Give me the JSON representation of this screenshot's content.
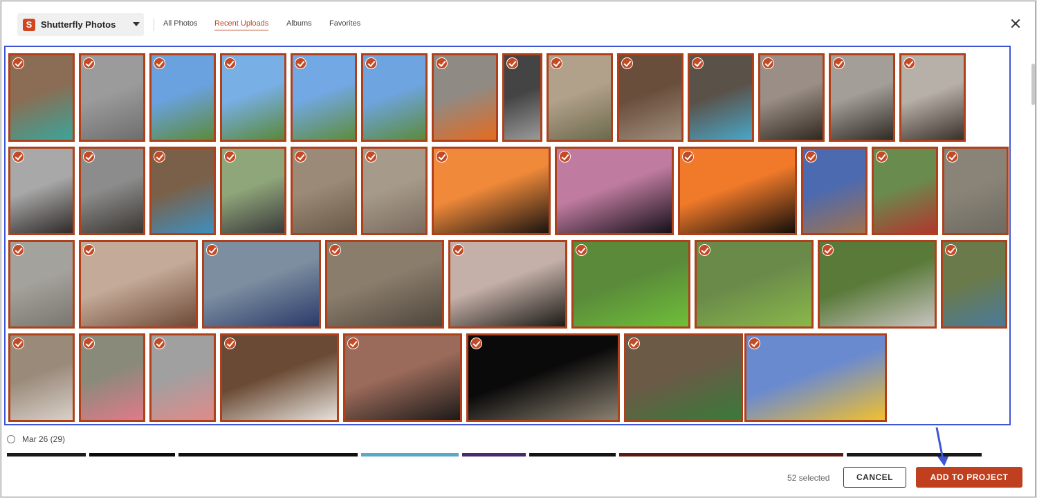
{
  "header": {
    "source_logo": "S",
    "source_name": "Shutterfly Photos",
    "tabs": [
      {
        "label": "All Photos",
        "active": false
      },
      {
        "label": "Recent Uploads",
        "active": true
      },
      {
        "label": "Albums",
        "active": false
      },
      {
        "label": "Favorites",
        "active": false
      }
    ],
    "close_icon": "close-icon"
  },
  "photos": {
    "all_selected": true,
    "count_shown": 52,
    "thumbnails": [
      {
        "subject": "dog",
        "c1": "#8a6d54",
        "c2": "#3aa59a"
      },
      {
        "subject": "floor",
        "c1": "#9b9b9b",
        "c2": "#6e6e6e"
      },
      {
        "subject": "horses",
        "c1": "#6aa2e0",
        "c2": "#5c8a3a"
      },
      {
        "subject": "horses",
        "c1": "#78afe5",
        "c2": "#5a8838"
      },
      {
        "subject": "horses",
        "c1": "#72a8e3",
        "c2": "#5e8c3c"
      },
      {
        "subject": "horses",
        "c1": "#6ea5e1",
        "c2": "#5c8a3a"
      },
      {
        "subject": "dog",
        "c1": "#8f8a84",
        "c2": "#e46b20"
      },
      {
        "subject": "screen",
        "c1": "#444444",
        "c2": "#9a9a9a"
      },
      {
        "subject": "dog",
        "c1": "#b1a08a",
        "c2": "#6c6a4c"
      },
      {
        "subject": "dog",
        "c1": "#6a4e3c",
        "c2": "#9f8e7c"
      },
      {
        "subject": "dog",
        "c1": "#5a5148",
        "c2": "#4aa6c8"
      },
      {
        "subject": "dog",
        "c1": "#9a8e86",
        "c2": "#30281f"
      },
      {
        "subject": "dog",
        "c1": "#a39e98",
        "c2": "#2f2a24"
      },
      {
        "subject": "dog",
        "c1": "#b7b0a8",
        "c2": "#3a302a"
      },
      {
        "subject": "dog",
        "c1": "#a8a8a8",
        "c2": "#2e2a28"
      },
      {
        "subject": "dog",
        "c1": "#8c8c8c",
        "c2": "#3a3530"
      },
      {
        "subject": "dog",
        "c1": "#7a6048",
        "c2": "#3f8fbf"
      },
      {
        "subject": "dog",
        "c1": "#8fa57a",
        "c2": "#3a3a3a"
      },
      {
        "subject": "dog",
        "c1": "#9c8a78",
        "c2": "#6a5848"
      },
      {
        "subject": "dog",
        "c1": "#a69b8a",
        "c2": "#7a6a5e"
      },
      {
        "subject": "sunset",
        "c1": "#f08a3a",
        "c2": "#1a1410"
      },
      {
        "subject": "sunset",
        "c1": "#c07ca0",
        "c2": "#141018"
      },
      {
        "subject": "sunset",
        "c1": "#f07a2a",
        "c2": "#140e0a"
      },
      {
        "subject": "dog",
        "c1": "#4c6ab0",
        "c2": "#a0724e"
      },
      {
        "subject": "dog",
        "c1": "#6a8b4e",
        "c2": "#b0362e"
      },
      {
        "subject": "dog",
        "c1": "#8a8478",
        "c2": "#6e6a60"
      },
      {
        "subject": "dog",
        "c1": "#a4a29c",
        "c2": "#7a7670"
      },
      {
        "subject": "dog",
        "c1": "#c4aa98",
        "c2": "#6e4a38"
      },
      {
        "subject": "dog",
        "c1": "#7c8ea0",
        "c2": "#2a3a6a"
      },
      {
        "subject": "dog",
        "c1": "#8a7d6c",
        "c2": "#4e463c"
      },
      {
        "subject": "sunset",
        "c1": "#c4b0a8",
        "c2": "#1c1a16"
      },
      {
        "subject": "dog",
        "c1": "#5a8a3a",
        "c2": "#6fbf3a"
      },
      {
        "subject": "dog",
        "c1": "#6a8a4a",
        "c2": "#8ab84a"
      },
      {
        "subject": "dog",
        "c1": "#5a7a3a",
        "c2": "#c8c4c0"
      },
      {
        "subject": "chair",
        "c1": "#6b7a4a",
        "c2": "#4a7a9a"
      },
      {
        "subject": "dog",
        "c1": "#9a8a7a",
        "c2": "#d8d0c8"
      },
      {
        "subject": "dog",
        "c1": "#8a8a7a",
        "c2": "#e07a8a"
      },
      {
        "subject": "dog",
        "c1": "#a0a0a0",
        "c2": "#e08a8a"
      },
      {
        "subject": "porch",
        "c1": "#6a4a34",
        "c2": "#e6e2dc"
      },
      {
        "subject": "sunset",
        "c1": "#9a6a5a",
        "c2": "#1c1a18"
      },
      {
        "subject": "dog",
        "c1": "#0a0a0a",
        "c2": "#8a8070"
      },
      {
        "subject": "people",
        "c1": "#6a5a46",
        "c2": "#3a7a3a"
      },
      {
        "subject": "pooh",
        "c1": "#6a8ad0",
        "c2": "#f0c030"
      }
    ]
  },
  "date_group": {
    "label": "Mar 26 (29)"
  },
  "footer": {
    "selected_text": "52 selected",
    "cancel_label": "CANCEL",
    "add_label": "ADD TO PROJECT"
  },
  "colors": {
    "brand_orange": "#bf3f1e",
    "selection_blue": "#3e55d6",
    "thumb_border": "#b0401a"
  }
}
